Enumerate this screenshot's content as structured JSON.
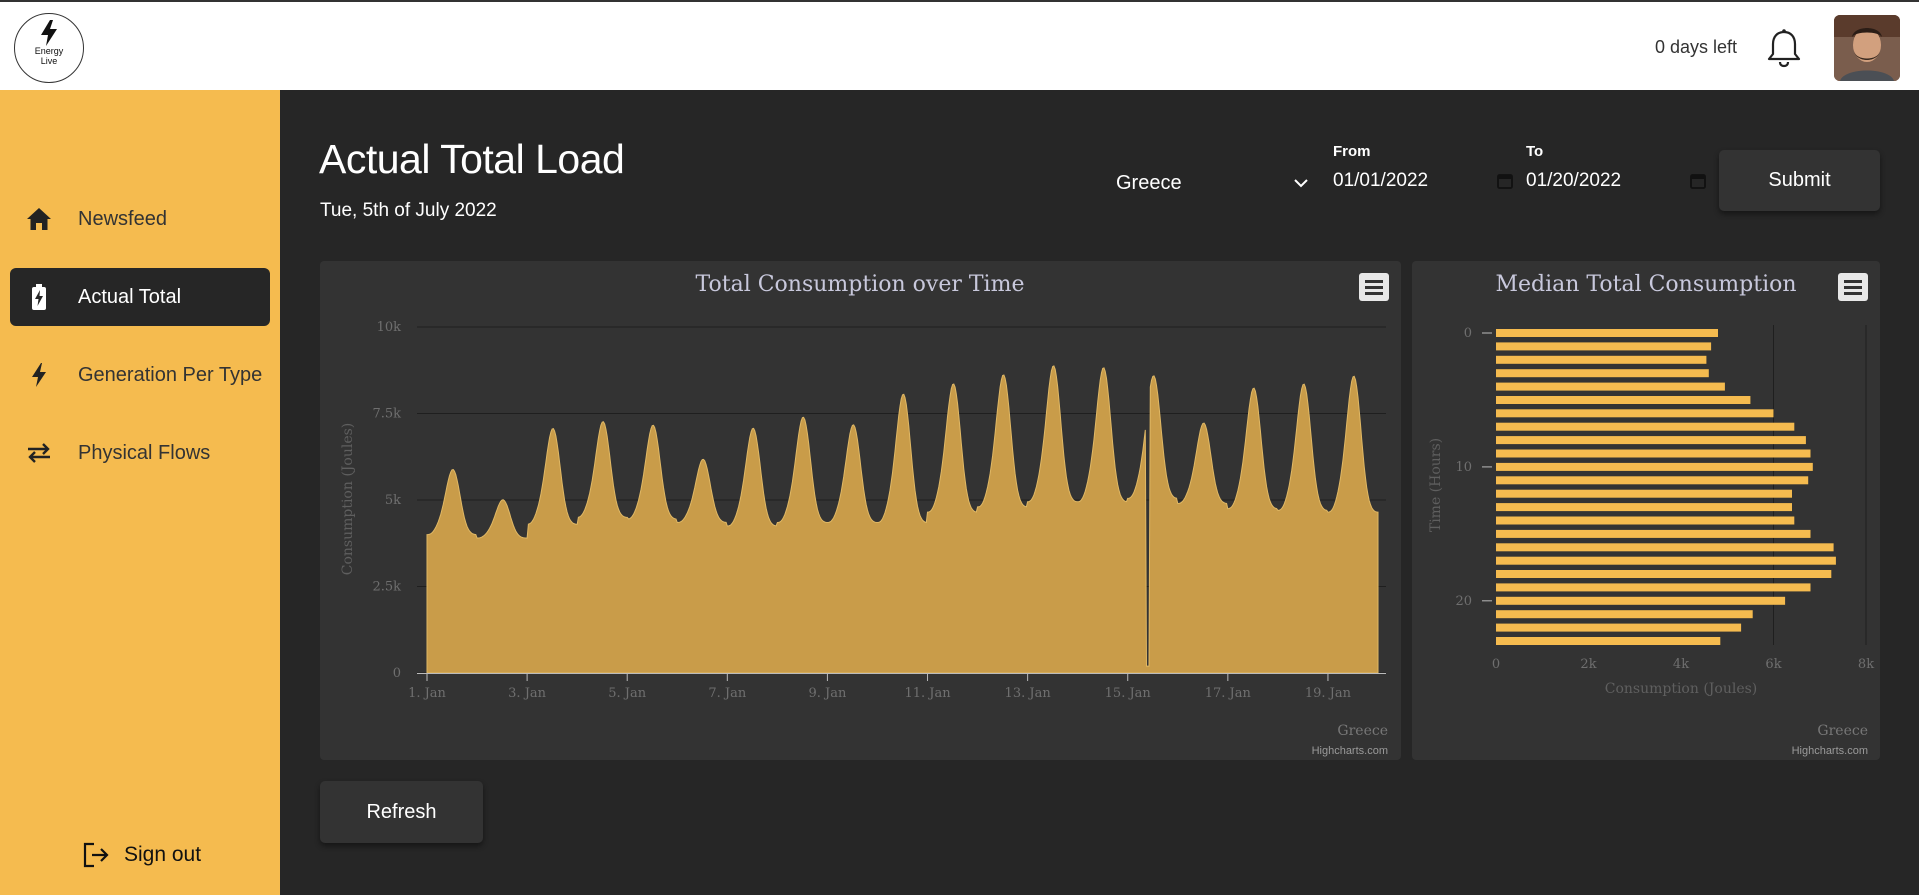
{
  "app": {
    "logo_line1": "Energy",
    "logo_line2": "Live",
    "days_left": "0 days left",
    "icons": {
      "logo": "bolt-icon",
      "bell": "bell-icon",
      "avatar": "user-avatar"
    }
  },
  "sidebar": {
    "items": [
      {
        "label": "Newsfeed",
        "icon": "home-icon",
        "active": false
      },
      {
        "label": "Actual Total",
        "icon": "battery-charging-icon",
        "active": true
      },
      {
        "label": "Generation Per Type",
        "icon": "bolt-icon",
        "active": false
      },
      {
        "label": "Physical Flows",
        "icon": "swap-arrows-icon",
        "active": false
      }
    ],
    "signout_label": "Sign out"
  },
  "page": {
    "title": "Actual Total Load",
    "date": "Tue, 5th of July 2022"
  },
  "filters": {
    "country": "Greece",
    "from_label": "From",
    "from_value": "01/01/2022",
    "to_label": "To",
    "to_value": "01/20/2022",
    "submit_label": "Submit"
  },
  "refresh_label": "Refresh",
  "colors": {
    "accent": "#f5bb4f",
    "background": "#262626",
    "panel": "#333333",
    "area_fill": "#c99c49",
    "bar_fill": "#f5bb4f"
  },
  "chart_data": [
    {
      "type": "area",
      "title": "Total Consumption over Time",
      "xlabel": "",
      "ylabel": "Consumption (Joules)",
      "x_ticks": [
        "1. Jan",
        "3. Jan",
        "5. Jan",
        "7. Jan",
        "9. Jan",
        "11. Jan",
        "13. Jan",
        "15. Jan",
        "17. Jan",
        "19. Jan"
      ],
      "y_ticks": [
        "0",
        "2.5k",
        "5k",
        "7.5k",
        "10k"
      ],
      "xlim": [
        0,
        19
      ],
      "ylim": [
        0,
        10000
      ],
      "series": [
        {
          "name": "Greece",
          "daily_min": [
            4000,
            3900,
            4300,
            4500,
            4450,
            4350,
            4250,
            4350,
            4350,
            4350,
            4650,
            4800,
            4950,
            4950,
            5050,
            4900,
            4750,
            4700,
            4650,
            4850
          ],
          "daily_max": [
            5700,
            4900,
            6800,
            7000,
            6900,
            6000,
            6800,
            7100,
            6900,
            7700,
            8000,
            8250,
            8500,
            8450,
            8250,
            7000,
            7900,
            8000,
            8200,
            8350
          ],
          "anomaly": {
            "x": 14.4,
            "value": 200
          }
        }
      ],
      "source_label": "Greece",
      "credit": "Highcharts.com",
      "grid": true,
      "legend": "none"
    },
    {
      "type": "bar",
      "orientation": "horizontal",
      "title": "Median Total Consumption",
      "xlabel": "Consumption (Joules)",
      "ylabel": "Time (Hours)",
      "x_ticks": [
        "0",
        "2k",
        "4k",
        "6k",
        "8k"
      ],
      "y_ticks": [
        "0",
        "10",
        "20"
      ],
      "xlim": [
        0,
        8000
      ],
      "categories": [
        0,
        1,
        2,
        3,
        4,
        5,
        6,
        7,
        8,
        9,
        10,
        11,
        12,
        13,
        14,
        15,
        16,
        17,
        18,
        19,
        20,
        21,
        22,
        23
      ],
      "values": [
        4800,
        4650,
        4550,
        4600,
        4950,
        5500,
        6000,
        6450,
        6700,
        6800,
        6850,
        6750,
        6400,
        6400,
        6450,
        6800,
        7300,
        7350,
        7250,
        6800,
        6250,
        5550,
        5300,
        4850
      ],
      "source_label": "Greece",
      "credit": "Highcharts.com",
      "grid": false,
      "legend": "none"
    }
  ]
}
